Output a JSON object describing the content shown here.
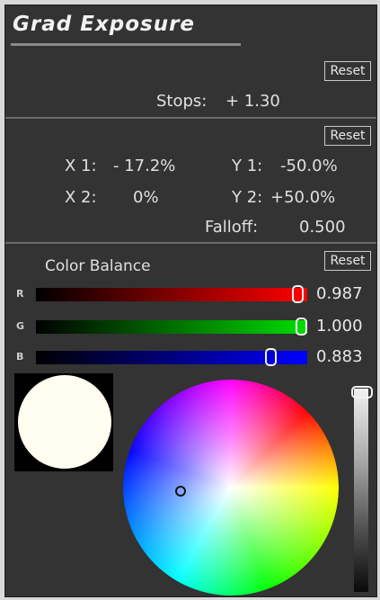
{
  "title": "Grad Exposure",
  "reset_label": "Reset",
  "exposure": {
    "stops_label": "Stops:",
    "stops_value": "+ 1.30"
  },
  "gradient": {
    "x1_label": "X 1:",
    "x1_value": "- 17.2%",
    "y1_label": "Y 1:",
    "y1_value": "-50.0%",
    "x2_label": "X 2:",
    "x2_value": "0%",
    "y2_label": "Y 2:",
    "y2_value": "+50.0%",
    "falloff_label": "Falloff:",
    "falloff_value": "0.500"
  },
  "color_balance": {
    "label": "Color Balance",
    "channels": [
      {
        "letter": "R",
        "value": "0.987",
        "level": 0.987,
        "color": "#ff0000"
      },
      {
        "letter": "G",
        "value": "1.000",
        "level": 1.0,
        "color": "#00dd00"
      },
      {
        "letter": "B",
        "value": "0.883",
        "level": 0.883,
        "color": "#0000ff"
      }
    ],
    "swatch_color": "#fefdf0",
    "brightness_level": 1.0
  }
}
